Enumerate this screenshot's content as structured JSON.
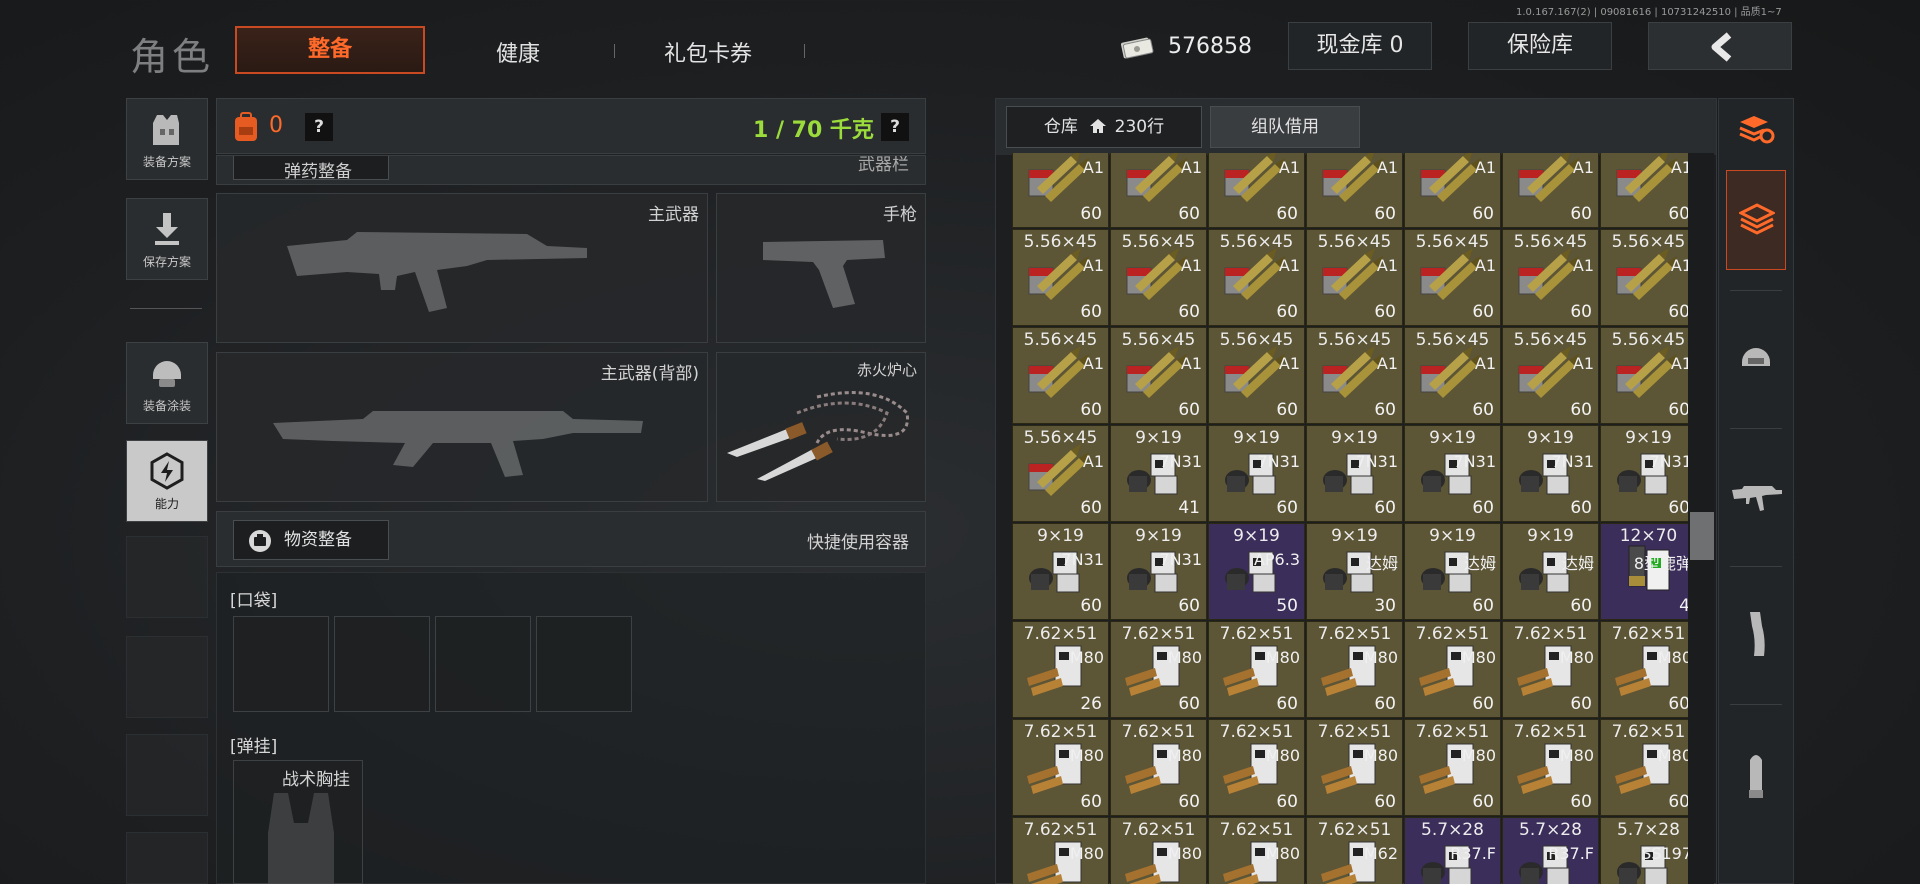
{
  "version": "1.0.167.167(2) | 09081616 | 10731242510 | 品质1~7",
  "header": {
    "title": "角色",
    "tabs": [
      {
        "label": "整备",
        "active": true
      },
      {
        "label": "健康",
        "active": false
      },
      {
        "label": "礼包卡券",
        "active": false
      }
    ],
    "money": "576858",
    "cash_vault": "现金库 0",
    "insurance_vault": "保险库"
  },
  "sidebar": {
    "items": [
      {
        "label": "装备方案",
        "icon": "vest-icon"
      },
      {
        "label": "保存方案",
        "icon": "download-icon"
      },
      {
        "label": "装备涂装",
        "icon": "helmet-icon"
      },
      {
        "label": "能力",
        "icon": "ability-hexagon-icon",
        "active": true
      }
    ]
  },
  "equipment": {
    "backpack_count": "0",
    "help": "?",
    "weight": "1 / 70 千克",
    "section_partial_left": "弹药整备",
    "section_partial_right": "武器栏",
    "slots": {
      "primary": "主武器",
      "pistol": "手枪",
      "primary_back": "主武器(背部)",
      "melee": "赤火炉心"
    },
    "supplies_button": "物资整备",
    "quick_container": "快捷使用容器",
    "pockets_label": "[口袋]",
    "rig_label": "[弹挂]",
    "rig_item": "战术胸挂"
  },
  "warehouse": {
    "tab_warehouse": "仓库",
    "tab_rows": "230行",
    "tab_team": "组队借用",
    "rows": [
      [
        {
          "cal": "",
          "var": "A1",
          "cnt": "60",
          "icon": "rifle-ammo-icon"
        },
        {
          "cal": "",
          "var": "A1",
          "cnt": "60",
          "icon": "rifle-ammo-icon"
        },
        {
          "cal": "",
          "var": "A1",
          "cnt": "60",
          "icon": "rifle-ammo-icon"
        },
        {
          "cal": "",
          "var": "A1",
          "cnt": "60",
          "icon": "rifle-ammo-icon"
        },
        {
          "cal": "",
          "var": "A1",
          "cnt": "60",
          "icon": "rifle-ammo-icon"
        },
        {
          "cal": "",
          "var": "A1",
          "cnt": "60",
          "icon": "rifle-ammo-icon"
        },
        {
          "cal": "",
          "var": "A1",
          "cnt": "60",
          "icon": "rifle-ammo-icon"
        }
      ],
      [
        {
          "cal": "5.56×45",
          "var": "A1",
          "cnt": "60",
          "icon": "rifle-ammo-icon"
        },
        {
          "cal": "5.56×45",
          "var": "A1",
          "cnt": "60",
          "icon": "rifle-ammo-icon"
        },
        {
          "cal": "5.56×45",
          "var": "A1",
          "cnt": "60",
          "icon": "rifle-ammo-icon"
        },
        {
          "cal": "5.56×45",
          "var": "A1",
          "cnt": "60",
          "icon": "rifle-ammo-icon"
        },
        {
          "cal": "5.56×45",
          "var": "A1",
          "cnt": "60",
          "icon": "rifle-ammo-icon"
        },
        {
          "cal": "5.56×45",
          "var": "A1",
          "cnt": "60",
          "icon": "rifle-ammo-icon"
        },
        {
          "cal": "5.56×45",
          "var": "A1",
          "cnt": "60",
          "icon": "rifle-ammo-icon"
        }
      ],
      [
        {
          "cal": "5.56×45",
          "var": "A1",
          "cnt": "60",
          "icon": "rifle-ammo-icon"
        },
        {
          "cal": "5.56×45",
          "var": "A1",
          "cnt": "60",
          "icon": "rifle-ammo-icon"
        },
        {
          "cal": "5.56×45",
          "var": "A1",
          "cnt": "60",
          "icon": "rifle-ammo-icon"
        },
        {
          "cal": "5.56×45",
          "var": "A1",
          "cnt": "60",
          "icon": "rifle-ammo-icon"
        },
        {
          "cal": "5.56×45",
          "var": "A1",
          "cnt": "60",
          "icon": "rifle-ammo-icon"
        },
        {
          "cal": "5.56×45",
          "var": "A1",
          "cnt": "60",
          "icon": "rifle-ammo-icon"
        },
        {
          "cal": "5.56×45",
          "var": "A1",
          "cnt": "60",
          "icon": "rifle-ammo-icon"
        }
      ],
      [
        {
          "cal": "5.56×45",
          "var": "A1",
          "cnt": "60",
          "icon": "rifle-ammo-icon"
        },
        {
          "cal": "9×19",
          "var": "7N31",
          "cnt": "41",
          "icon": "pistol-ammo-icon"
        },
        {
          "cal": "9×19",
          "var": "7N31",
          "cnt": "60",
          "icon": "pistol-ammo-icon"
        },
        {
          "cal": "9×19",
          "var": "7N31",
          "cnt": "60",
          "icon": "pistol-ammo-icon"
        },
        {
          "cal": "9×19",
          "var": "7N31",
          "cnt": "60",
          "icon": "pistol-ammo-icon"
        },
        {
          "cal": "9×19",
          "var": "7N31",
          "cnt": "60",
          "icon": "pistol-ammo-icon"
        },
        {
          "cal": "9×19",
          "var": "7N31",
          "cnt": "60",
          "icon": "pistol-ammo-icon"
        }
      ],
      [
        {
          "cal": "9×19",
          "var": "7N31",
          "cnt": "60",
          "icon": "pistol-ammo-icon"
        },
        {
          "cal": "9×19",
          "var": "7N31",
          "cnt": "60",
          "icon": "pistol-ammo-icon"
        },
        {
          "cal": "9×19",
          "var": "AP6.3",
          "cnt": "50",
          "icon": "pistol-ammo-icon",
          "rare": true
        },
        {
          "cal": "9×19",
          "var": "达姆",
          "cnt": "30",
          "icon": "pistol-ammo-icon"
        },
        {
          "cal": "9×19",
          "var": "达姆",
          "cnt": "60",
          "icon": "pistol-ammo-icon"
        },
        {
          "cal": "9×19",
          "var": "达姆",
          "cnt": "60",
          "icon": "pistol-ammo-icon"
        },
        {
          "cal": "12×70",
          "var": "8型鹿弹",
          "cnt": "4",
          "icon": "shotgun-shell-icon",
          "rare": true
        }
      ],
      [
        {
          "cal": "7.62×51",
          "var": "M80",
          "cnt": "26",
          "icon": "rifle-ammo-box-icon"
        },
        {
          "cal": "7.62×51",
          "var": "M80",
          "cnt": "60",
          "icon": "rifle-ammo-box-icon"
        },
        {
          "cal": "7.62×51",
          "var": "M80",
          "cnt": "60",
          "icon": "rifle-ammo-box-icon"
        },
        {
          "cal": "7.62×51",
          "var": "M80",
          "cnt": "60",
          "icon": "rifle-ammo-box-icon"
        },
        {
          "cal": "7.62×51",
          "var": "M80",
          "cnt": "60",
          "icon": "rifle-ammo-box-icon"
        },
        {
          "cal": "7.62×51",
          "var": "M80",
          "cnt": "60",
          "icon": "rifle-ammo-box-icon"
        },
        {
          "cal": "7.62×51",
          "var": "M80",
          "cnt": "60",
          "icon": "rifle-ammo-box-icon"
        }
      ],
      [
        {
          "cal": "7.62×51",
          "var": "M80",
          "cnt": "60",
          "icon": "rifle-ammo-box-icon"
        },
        {
          "cal": "7.62×51",
          "var": "M80",
          "cnt": "60",
          "icon": "rifle-ammo-box-icon"
        },
        {
          "cal": "7.62×51",
          "var": "M80",
          "cnt": "60",
          "icon": "rifle-ammo-box-icon"
        },
        {
          "cal": "7.62×51",
          "var": "M80",
          "cnt": "60",
          "icon": "rifle-ammo-box-icon"
        },
        {
          "cal": "7.62×51",
          "var": "M80",
          "cnt": "60",
          "icon": "rifle-ammo-box-icon"
        },
        {
          "cal": "7.62×51",
          "var": "M80",
          "cnt": "60",
          "icon": "rifle-ammo-box-icon"
        },
        {
          "cal": "7.62×51",
          "var": "M80",
          "cnt": "60",
          "icon": "rifle-ammo-box-icon"
        }
      ],
      [
        {
          "cal": "7.62×51",
          "var": "M80",
          "cnt": "",
          "icon": "rifle-ammo-box-icon"
        },
        {
          "cal": "7.62×51",
          "var": "M80",
          "cnt": "",
          "icon": "rifle-ammo-box-icon"
        },
        {
          "cal": "7.62×51",
          "var": "M80",
          "cnt": "",
          "icon": "rifle-ammo-box-icon"
        },
        {
          "cal": "7.62×51",
          "var": "M62",
          "cnt": "",
          "icon": "rifle-ammo-box-icon"
        },
        {
          "cal": "5.7×28",
          "var": "R37.F",
          "cnt": "",
          "icon": "pistol-ammo-icon",
          "rare": true
        },
        {
          "cal": "5.7×28",
          "var": "R37.F",
          "cnt": "",
          "icon": "pistol-ammo-icon",
          "rare": true
        },
        {
          "cal": "5.7×28",
          "var": "SS197",
          "cnt": "",
          "icon": "pistol-ammo-icon"
        }
      ]
    ]
  },
  "filters": [
    {
      "icon": "stack-refresh-icon"
    },
    {
      "icon": "all-items-stack-icon",
      "active": true
    },
    {
      "icon": "helmet-filter-icon"
    },
    {
      "icon": "rifle-filter-icon"
    },
    {
      "icon": "magazine-filter-icon"
    },
    {
      "icon": "bullet-filter-icon"
    }
  ],
  "colors": {
    "accent": "#ff6a2a",
    "weight_ok": "#9bdc3c",
    "cell_normal": "#5c5536",
    "cell_rare": "#3c2e5b"
  }
}
